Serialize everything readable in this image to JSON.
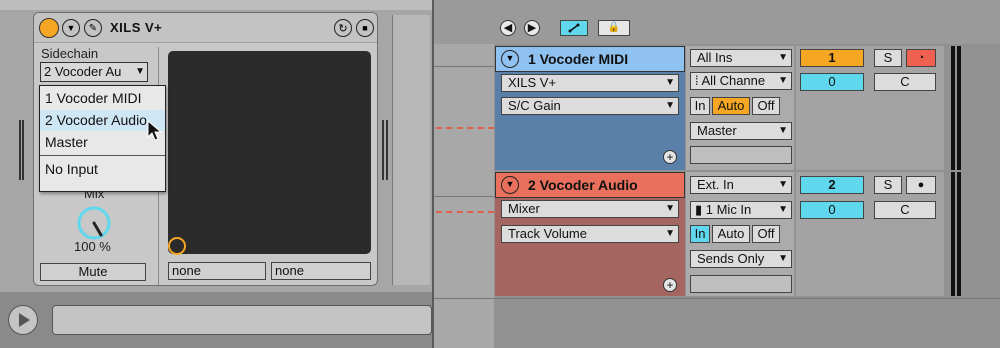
{
  "device": {
    "plugin_title": "XILS V+",
    "sidechain_label": "Sidechain",
    "sidechain_value": "2 Vocoder Au",
    "dropdown_options": [
      "1 Vocoder MIDI",
      "2 Vocoder Audio",
      "Master",
      "No Input"
    ],
    "selected_option": "2 Vocoder Audio",
    "mix_label": "Mix",
    "mix_value": "100 %",
    "mute_label": "Mute",
    "pad_x_value": "none",
    "pad_y_value": "none"
  },
  "tracks": [
    {
      "name": "1 Vocoder MIDI",
      "device_slot": "XILS V+",
      "param_slot": "S/C Gain",
      "input_type": "All Ins",
      "input_channel": "All Channe",
      "monitor": [
        "In",
        "Auto",
        "Off"
      ],
      "monitor_active": "Auto",
      "output": "Master",
      "track_number": "1",
      "send_a": "0",
      "solo": "S",
      "pan": "C",
      "header_color": "#8fc2f0",
      "body_color": "#5a7fa8"
    },
    {
      "name": "2 Vocoder Audio",
      "device_slot": "Mixer",
      "param_slot": "Track Volume",
      "input_type": "Ext. In",
      "input_channel": "1 Mic In",
      "monitor": [
        "In",
        "Auto",
        "Off"
      ],
      "monitor_active": "In",
      "output": "Sends Only",
      "track_number": "2",
      "send_a": "0",
      "solo": "S",
      "pan": "C",
      "header_color": "#e8705c",
      "body_color": "#a56560"
    }
  ],
  "colors": {
    "accent_orange": "#f5a623",
    "accent_cyan": "#5fd8ee",
    "record_red": "#f06050",
    "selection_blue": "#cfe6f5"
  }
}
